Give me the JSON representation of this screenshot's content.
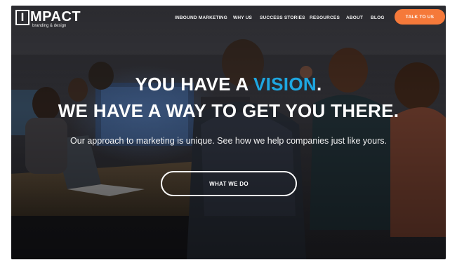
{
  "logo": {
    "main": "IMPACT",
    "sub": "branding & design"
  },
  "nav": {
    "links": [
      "INBOUND MARKETING",
      "WHY US",
      "SUCCESS STORIES",
      "RESOURCES",
      "ABOUT",
      "BLOG"
    ],
    "cta": "TALK TO US"
  },
  "hero": {
    "line1_pre": "YOU HAVE A ",
    "line1_highlight": "VISION",
    "line1_post": ".",
    "line2": "WE HAVE A WAY TO GET YOU THERE.",
    "subtitle": "Our approach to marketing is unique. See how we help companies just like yours.",
    "button": "WHAT WE DO"
  },
  "colors": {
    "accent_orange": "#f5793a",
    "accent_blue": "#1ea7e1"
  }
}
